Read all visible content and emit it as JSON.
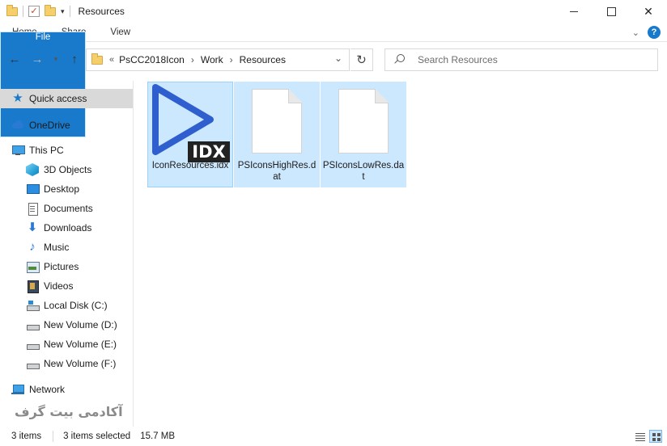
{
  "window": {
    "title": "Resources",
    "controls": {
      "minimize": "—",
      "maximize": "☐",
      "close": "✕"
    }
  },
  "ribbon": {
    "tabs": [
      {
        "label": "File",
        "active": true
      },
      {
        "label": "Home"
      },
      {
        "label": "Share"
      },
      {
        "label": "View"
      }
    ],
    "help_label": "?"
  },
  "navigation": {
    "back_icon": "arrow-left-icon",
    "forward_icon": "arrow-right-icon",
    "up_icon": "arrow-up-icon",
    "address": {
      "overflow": "«",
      "crumbs": [
        "PsCC2018Icon",
        "Work",
        "Resources"
      ],
      "separator": "›"
    },
    "search": {
      "placeholder": "Search Resources",
      "value": ""
    }
  },
  "sidebar": {
    "items": [
      {
        "label": "Quick access",
        "icon": "star-icon",
        "selected": true
      },
      {
        "label": "OneDrive",
        "icon": "cloud-icon"
      },
      {
        "label": "This PC",
        "icon": "computer-icon"
      },
      {
        "label": "3D Objects",
        "icon": "cube-icon"
      },
      {
        "label": "Desktop",
        "icon": "desktop-icon"
      },
      {
        "label": "Documents",
        "icon": "document-icon"
      },
      {
        "label": "Downloads",
        "icon": "download-icon"
      },
      {
        "label": "Music",
        "icon": "music-icon"
      },
      {
        "label": "Pictures",
        "icon": "pictures-icon"
      },
      {
        "label": "Videos",
        "icon": "video-icon"
      },
      {
        "label": "Local Disk (C:)",
        "icon": "local-disk-icon"
      },
      {
        "label": "New Volume (D:)",
        "icon": "drive-icon"
      },
      {
        "label": "New Volume (E:)",
        "icon": "drive-icon"
      },
      {
        "label": "New Volume (F:)",
        "icon": "drive-icon"
      },
      {
        "label": "Network",
        "icon": "network-icon"
      }
    ]
  },
  "files": [
    {
      "name": "IconResources.idx",
      "icon": "idx-file-icon",
      "badge": "IDX",
      "selected": true
    },
    {
      "name": "PSIconsHighRes.dat",
      "icon": "blank-file-icon",
      "selected": true
    },
    {
      "name": "PSIconsLowRes.dat",
      "icon": "blank-file-icon",
      "selected": true
    }
  ],
  "watermark": "آکادمی بیت گرف",
  "status": {
    "item_count": "3 items",
    "selected": "3 items selected",
    "size": "15.7 MB"
  },
  "colors": {
    "accent": "#1979ca",
    "selection": "#cce8ff",
    "idx_play": "#2f5fcf"
  }
}
